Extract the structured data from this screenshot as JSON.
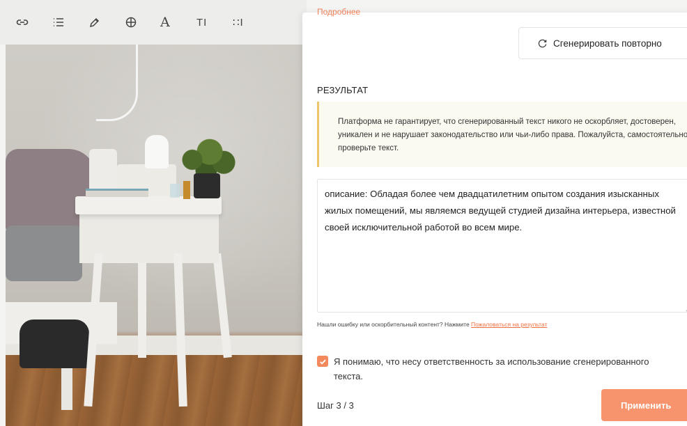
{
  "toolbar": {
    "icons": [
      "link-icon",
      "list-icon",
      "pen-icon",
      "globe-icon",
      "font-icon",
      "text-height-icon",
      "line-spacing-icon"
    ],
    "font_glyph": "A",
    "text_height_glyph": "TI",
    "line_spacing_glyph": "∷I"
  },
  "panel": {
    "cut_link": "Подробнее",
    "regenerate_label": "Сгенерировать повторно",
    "result_title": "РЕЗУЛЬТАТ",
    "warning_text": "Платформа не гарантирует, что сгенерированный текст никого не оскорбляет, достоверен, уникален и не нарушает законодательство или чьи-либо права. Пожалуйста, самостоятельно проверьте текст.",
    "result_text": "описание: Обладая более чем двадцатилетним опытом создания изысканных жилых помещений, мы являемся ведущей студией дизайна интерьера, известной своей исключительной работой во всем мире.",
    "report_prefix": "Нашли ошибку или оскорбительный контент? Нажмите",
    "report_link": "Пожаловаться на результат",
    "consent_text": "Я понимаю, что несу ответственность за использование сгенерированного текста.",
    "consent_checked": true,
    "step_label": "Шаг 3 / 3",
    "apply_label": "Применить"
  },
  "colors": {
    "accent": "#f7936d",
    "warning_border": "#f0c36d",
    "warning_bg": "#fbfaf0"
  }
}
